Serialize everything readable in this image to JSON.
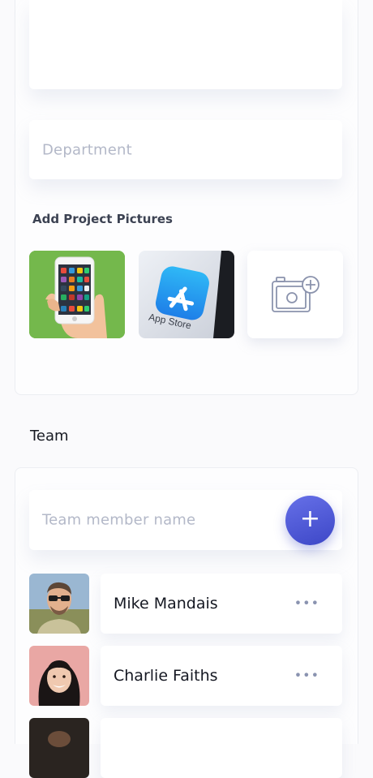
{
  "form": {
    "description_value": "",
    "department_placeholder": "Department"
  },
  "pictures": {
    "label": "Add Project Pictures",
    "items": [
      {
        "name": "phone-apps-photo"
      },
      {
        "name": "app-store-photo",
        "caption": "App Store"
      },
      {
        "name": "add-photo-tile",
        "icon": "camera-plus-icon"
      }
    ]
  },
  "team": {
    "title": "Team",
    "input_placeholder": "Team member name",
    "add_label": "+",
    "members": [
      {
        "name": "Mike Mandais",
        "more": "•••"
      },
      {
        "name": "Charlie Faiths",
        "more": "•••"
      },
      {
        "name": "",
        "more": ""
      }
    ]
  },
  "colors": {
    "accent": "#4b55d6",
    "placeholder": "#b3b8c8",
    "text": "#151822"
  }
}
